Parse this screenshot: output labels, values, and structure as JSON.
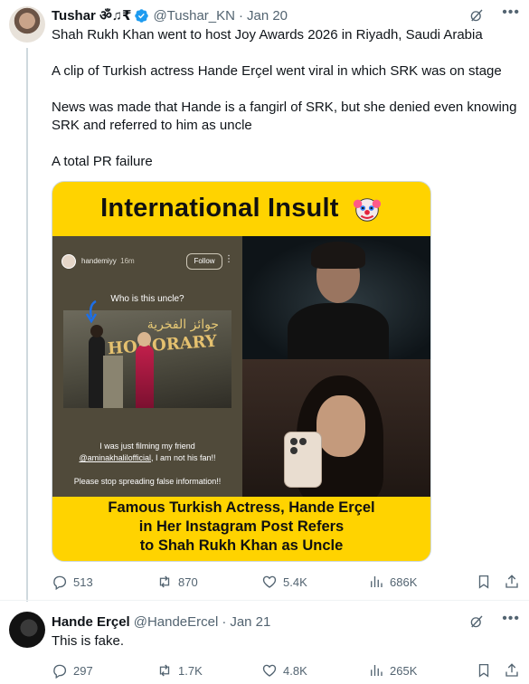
{
  "tweet1": {
    "name": "Tushar ॐ♫₹",
    "handle": "@Tushar_KN",
    "separator": "·",
    "date": "Jan 20",
    "paragraphs": [
      "Shah Rukh Khan went to host Joy Awards 2026 in Riyadh, Saudi Arabia",
      "A clip of Turkish actress Hande Erçel went viral in which SRK was on stage",
      "News was made that Hande is a fangirl of SRK, but she denied even knowing SRK and referred to him as uncle",
      "A total PR failure"
    ],
    "media": {
      "title": "International Insult",
      "story_user": "handemiyy",
      "story_time": "16m",
      "story_follow": "Follow",
      "story_question": "Who is this uncle?",
      "stage_arabic": "جوائز الفخرية",
      "stage_text": "HONORARY",
      "story_caption_1": "I was just filming  my friend",
      "story_caption_mention": "@aminakhalilofficial",
      "story_caption_2": ", I am not his fan!!",
      "story_caption_3": "Please stop spreading false information!!",
      "bottom_line_1": "Famous Turkish Actress, Hande Erçel",
      "bottom_line_2": "in Her Instagram Post Refers",
      "bottom_line_3": "to Shah Rukh Khan as Uncle"
    },
    "stats": {
      "replies": "513",
      "reposts": "870",
      "likes": "5.4K",
      "views": "686K"
    }
  },
  "tweet2": {
    "name": "Hande Erçel",
    "handle": "@HandeErcel",
    "separator": "·",
    "date": "Jan 21",
    "text": "This is fake.",
    "stats": {
      "replies": "297",
      "reposts": "1.7K",
      "likes": "4.8K",
      "views": "265K"
    }
  },
  "colors": {
    "text": "#0f1419",
    "muted": "#536471",
    "verified": "#1d9bf0",
    "media_yellow": "#ffd300"
  },
  "icons": [
    "verified-badge-icon",
    "grok-icon",
    "more-icon",
    "reply-icon",
    "repost-icon",
    "like-icon",
    "views-icon",
    "bookmark-icon",
    "share-icon",
    "clown-emoji"
  ]
}
